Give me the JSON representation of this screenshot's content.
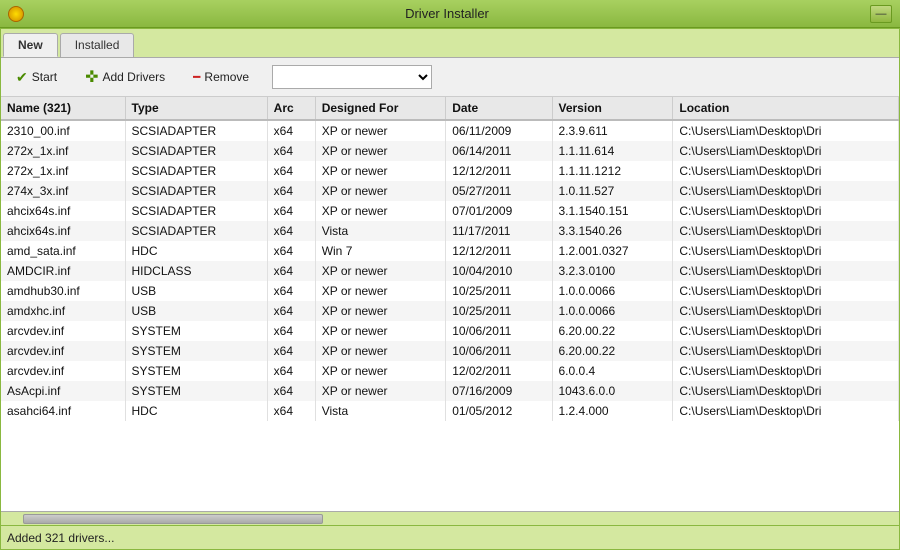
{
  "titleBar": {
    "title": "Driver Installer",
    "closeBtn": "—"
  },
  "tabs": [
    {
      "label": "New",
      "active": true
    },
    {
      "label": "Installed",
      "active": false
    }
  ],
  "toolbar": {
    "startLabel": "Start",
    "addDriversLabel": "Add Drivers",
    "removeLabel": "Remove",
    "dropdownPlaceholder": ""
  },
  "table": {
    "columns": [
      {
        "label": "Name (321)",
        "key": "name"
      },
      {
        "label": "Type",
        "key": "type"
      },
      {
        "label": "Arc",
        "key": "arc"
      },
      {
        "label": "Designed For",
        "key": "designedFor"
      },
      {
        "label": "Date",
        "key": "date"
      },
      {
        "label": "Version",
        "key": "version"
      },
      {
        "label": "Location",
        "key": "location"
      }
    ],
    "rows": [
      {
        "name": "2310_00.inf",
        "type": "SCSIADAPTER",
        "arc": "x64",
        "designedFor": "XP or newer",
        "date": "06/11/2009",
        "version": "2.3.9.611",
        "location": "C:\\Users\\Liam\\Desktop\\Dri"
      },
      {
        "name": "272x_1x.inf",
        "type": "SCSIADAPTER",
        "arc": "x64",
        "designedFor": "XP or newer",
        "date": "06/14/2011",
        "version": "1.1.11.614",
        "location": "C:\\Users\\Liam\\Desktop\\Dri"
      },
      {
        "name": "272x_1x.inf",
        "type": "SCSIADAPTER",
        "arc": "x64",
        "designedFor": "XP or newer",
        "date": "12/12/2011",
        "version": "1.1.11.1212",
        "location": "C:\\Users\\Liam\\Desktop\\Dri"
      },
      {
        "name": "274x_3x.inf",
        "type": "SCSIADAPTER",
        "arc": "x64",
        "designedFor": "XP or newer",
        "date": "05/27/2011",
        "version": "1.0.11.527",
        "location": "C:\\Users\\Liam\\Desktop\\Dri"
      },
      {
        "name": "ahcix64s.inf",
        "type": "SCSIADAPTER",
        "arc": "x64",
        "designedFor": "XP or newer",
        "date": "07/01/2009",
        "version": "3.1.1540.151",
        "location": "C:\\Users\\Liam\\Desktop\\Dri"
      },
      {
        "name": "ahcix64s.inf",
        "type": "SCSIADAPTER",
        "arc": "x64",
        "designedFor": "Vista",
        "date": "11/17/2011",
        "version": "3.3.1540.26",
        "location": "C:\\Users\\Liam\\Desktop\\Dri"
      },
      {
        "name": "amd_sata.inf",
        "type": "HDC",
        "arc": "x64",
        "designedFor": "Win 7",
        "date": "12/12/2011",
        "version": "1.2.001.0327",
        "location": "C:\\Users\\Liam\\Desktop\\Dri"
      },
      {
        "name": "AMDCIR.inf",
        "type": "HIDCLASS",
        "arc": "x64",
        "designedFor": "XP or newer",
        "date": "10/04/2010",
        "version": "3.2.3.0100",
        "location": "C:\\Users\\Liam\\Desktop\\Dri"
      },
      {
        "name": "amdhub30.inf",
        "type": "USB",
        "arc": "x64",
        "designedFor": "XP or newer",
        "date": "10/25/2011",
        "version": "1.0.0.0066",
        "location": "C:\\Users\\Liam\\Desktop\\Dri"
      },
      {
        "name": "amdxhc.inf",
        "type": "USB",
        "arc": "x64",
        "designedFor": "XP or newer",
        "date": "10/25/2011",
        "version": "1.0.0.0066",
        "location": "C:\\Users\\Liam\\Desktop\\Dri"
      },
      {
        "name": "arcvdev.inf",
        "type": "SYSTEM",
        "arc": "x64",
        "designedFor": "XP or newer",
        "date": "10/06/2011",
        "version": "6.20.00.22",
        "location": "C:\\Users\\Liam\\Desktop\\Dri"
      },
      {
        "name": "arcvdev.inf",
        "type": "SYSTEM",
        "arc": "x64",
        "designedFor": "XP or newer",
        "date": "10/06/2011",
        "version": "6.20.00.22",
        "location": "C:\\Users\\Liam\\Desktop\\Dri"
      },
      {
        "name": "arcvdev.inf",
        "type": "SYSTEM",
        "arc": "x64",
        "designedFor": "XP or newer",
        "date": "12/02/2011",
        "version": "6.0.0.4",
        "location": "C:\\Users\\Liam\\Desktop\\Dri"
      },
      {
        "name": "AsAcpi.inf",
        "type": "SYSTEM",
        "arc": "x64",
        "designedFor": "XP or newer",
        "date": "07/16/2009",
        "version": "1043.6.0.0",
        "location": "C:\\Users\\Liam\\Desktop\\Dri"
      },
      {
        "name": "asahci64.inf",
        "type": "HDC",
        "arc": "x64",
        "designedFor": "Vista",
        "date": "01/05/2012",
        "version": "1.2.4.000",
        "location": "C:\\Users\\Liam\\Desktop\\Dri"
      }
    ]
  },
  "statusBar": {
    "text": "Added 321 drivers..."
  }
}
